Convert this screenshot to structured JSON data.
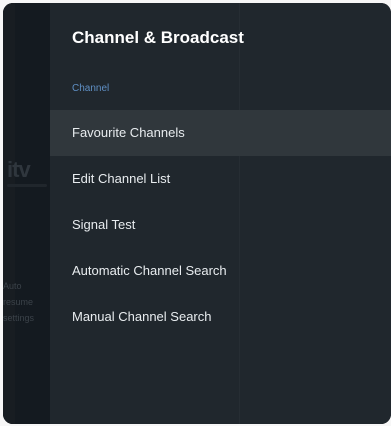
{
  "background": {
    "logo_text": "itv",
    "snippet_lines": [
      "Auto",
      "resume",
      "settings"
    ]
  },
  "panel": {
    "title": "Channel & Broadcast",
    "section_label": "Channel",
    "items": [
      {
        "label": "Favourite Channels",
        "focused": true
      },
      {
        "label": "Edit Channel List",
        "focused": false
      },
      {
        "label": "Signal Test",
        "focused": false
      },
      {
        "label": "Automatic Channel Search",
        "focused": false
      },
      {
        "label": "Manual Channel Search",
        "focused": false
      }
    ]
  },
  "colors": {
    "panel_bg": "#20272d",
    "focused_bg": "#30373c",
    "section_label": "#5f8fc4",
    "text": "#e8ecef"
  }
}
